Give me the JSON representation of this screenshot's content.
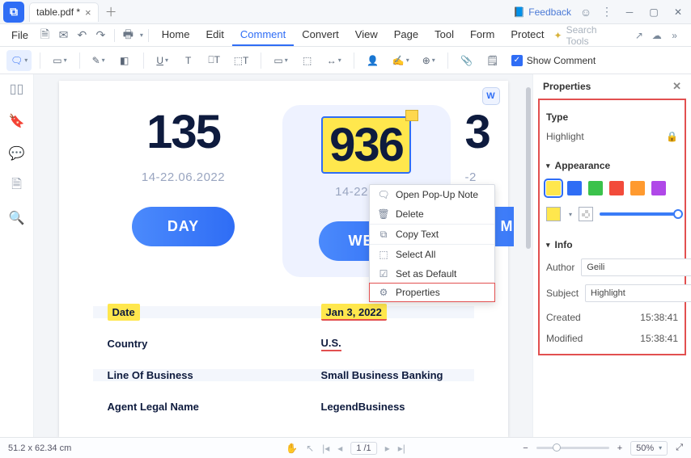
{
  "titlebar": {
    "tab_title": "table.pdf *",
    "feedback": "Feedback"
  },
  "menubar": {
    "file": "File",
    "items": [
      "Home",
      "Edit",
      "Comment",
      "Convert",
      "View",
      "Page",
      "Tool",
      "Form",
      "Protect"
    ],
    "active_index": 2,
    "search_placeholder": "Search Tools"
  },
  "ribbon": {
    "show_comment": "Show Comment"
  },
  "document": {
    "cards": [
      {
        "number": "135",
        "range": "14-22.06.2022",
        "pill": "DAY"
      },
      {
        "number": "936",
        "range": "14-22.06.2",
        "pill": "WEE"
      },
      {
        "number": "3",
        "range": "-2",
        "pill": "M"
      }
    ],
    "table": [
      {
        "label": "Date",
        "value": "Jan 3, 2022"
      },
      {
        "label": "Country",
        "value": "U.S."
      },
      {
        "label": "Line Of Business",
        "value": "Small Business Banking"
      },
      {
        "label": "Agent Legal Name",
        "value": "LegendBusiness"
      }
    ]
  },
  "context_menu": {
    "items": [
      "Open Pop-Up Note",
      "Delete",
      "Copy Text",
      "Select All",
      "Set as Default",
      "Properties"
    ]
  },
  "properties": {
    "title": "Properties",
    "type_label": "Type",
    "type_value": "Highlight",
    "appearance_label": "Appearance",
    "colors": [
      "#ffe74d",
      "#2f6df5",
      "#3bc24b",
      "#f24b3b",
      "#ff9a2f",
      "#b048e8"
    ],
    "selected_color_index": 0,
    "info_label": "Info",
    "author_label": "Author",
    "author_value": "Geili",
    "subject_label": "Subject",
    "subject_value": "Highlight",
    "created_label": "Created",
    "created_value": "15:38:41",
    "modified_label": "Modified",
    "modified_value": "15:38:41"
  },
  "status": {
    "dims": "51.2 x 62.34 cm",
    "page_indicator": "1 /1",
    "zoom": "50%"
  }
}
